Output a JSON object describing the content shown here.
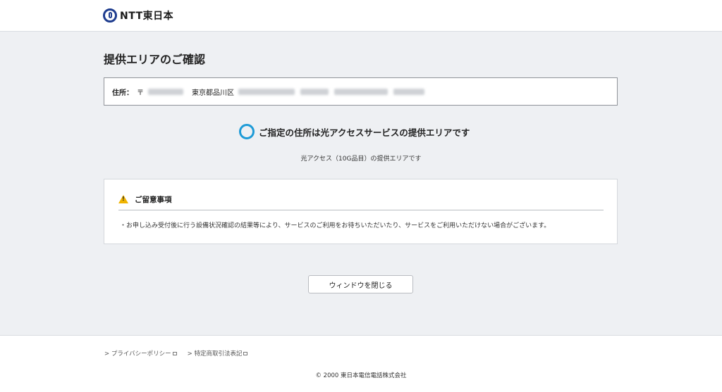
{
  "header": {
    "logo_text": "NTT東日本"
  },
  "main": {
    "title": "提供エリアのご確認",
    "address": {
      "label": "住所：",
      "postal_prefix": "〒",
      "city": "東京都品川区"
    },
    "result": {
      "message": "ご指定の住所は光アクセスサービスの提供エリアです",
      "detail": "光アクセス（10G品目）の提供エリアです"
    },
    "notice": {
      "title": "ご留意事項",
      "body": "・お申し込み受付後に行う設備状況確認の結果等により、サービスのご利用をお待ちいただいたり、サービスをご利用いただけない場合がございます。"
    },
    "close_button": "ウィンドウを閉じる"
  },
  "footer": {
    "links": [
      {
        "label": "> プライバシーポリシー"
      },
      {
        "label": "> 特定商取引法表記"
      }
    ],
    "copyright": "© 2000 東日本電信電話株式会社"
  },
  "colors": {
    "accent_ring": "#1e9bd7",
    "logo_blue": "#1f3d8f",
    "warning": "#f0b400"
  }
}
